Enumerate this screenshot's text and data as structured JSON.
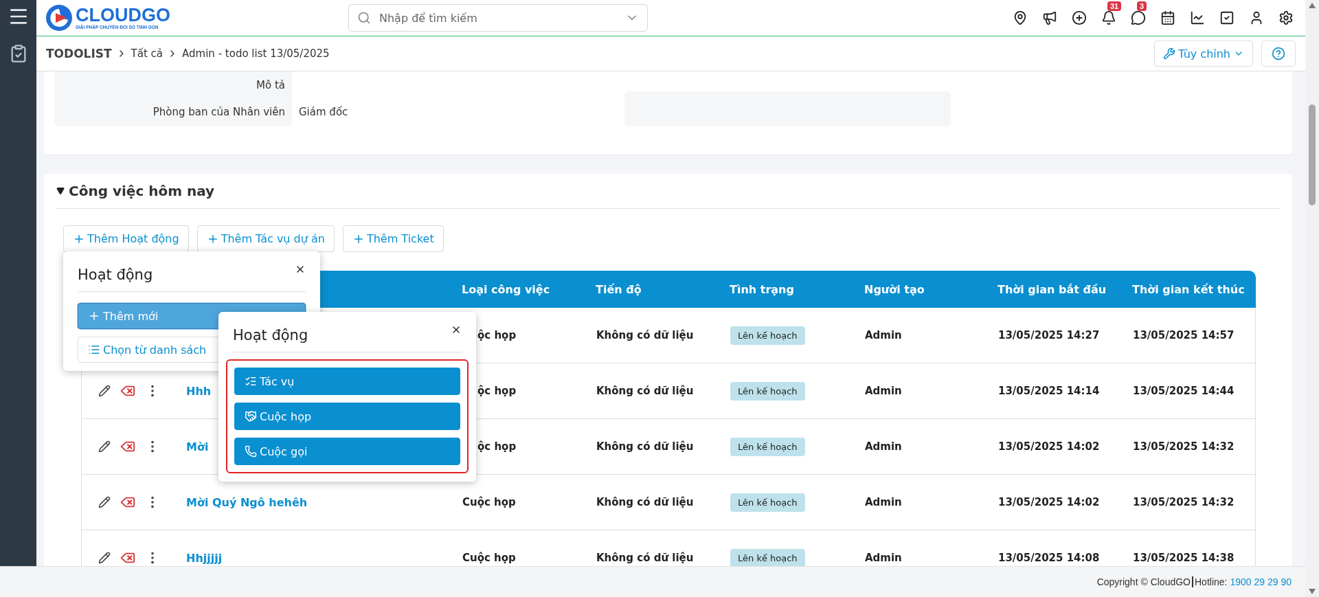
{
  "header": {
    "logo": {
      "name": "CLOUDGO",
      "tagline": "GIẢI PHÁP CHUYỂN ĐỔI SỐ TINH GỌN"
    },
    "search": {
      "placeholder": "Nhập để tìm kiếm"
    },
    "icons": [
      {
        "kind": "location"
      },
      {
        "kind": "megaphone"
      },
      {
        "kind": "add"
      },
      {
        "kind": "bell",
        "badge": "31"
      },
      {
        "kind": "chat",
        "badge": "3"
      },
      {
        "kind": "calendar"
      },
      {
        "kind": "chart"
      },
      {
        "kind": "check"
      },
      {
        "kind": "user"
      },
      {
        "kind": "settings"
      }
    ]
  },
  "breadcrumb": [
    "TODOLIST",
    "Tất cả",
    "Admin - todo list 13/05/2025"
  ],
  "toolbar": {
    "customize": "Tùy chỉnh"
  },
  "details": [
    {
      "label": "Mô tả"
    },
    {
      "label": "Phòng ban của Nhân viên",
      "value": "Giám đốc"
    }
  ],
  "section": {
    "title": "Công việc hôm nay",
    "expanded": true,
    "buttons": [
      "Thêm Hoạt động",
      "Thêm Tác vụ dự án",
      "Thêm Ticket"
    ]
  },
  "table": {
    "columns": [
      "Loại công việc",
      "Tiến độ",
      "Tình trạng",
      "Người tạo",
      "Thời gian bắt đầu",
      "Thời gian kết thúc"
    ],
    "rows": [
      {
        "actions": false,
        "covered": true,
        "type": "ộc họp",
        "progress": "Không có dữ liệu",
        "status": "Lên kế hoạch",
        "creator": "Admin",
        "start": "13/05/2025 14:27",
        "end": "13/05/2025 14:57"
      },
      {
        "actions": true,
        "covered": true,
        "name": "Hhh",
        "type": "ộc họp",
        "progress": "Không có dữ liệu",
        "status": "Lên kế hoạch",
        "creator": "Admin",
        "start": "13/05/2025 14:14",
        "end": "13/05/2025 14:44"
      },
      {
        "actions": true,
        "covered": true,
        "name": "Mời",
        "type": "ộc họp",
        "progress": "Không có dữ liệu",
        "status": "Lên kế hoạch",
        "creator": "Admin",
        "start": "13/05/2025 14:02",
        "end": "13/05/2025 14:32"
      },
      {
        "actions": true,
        "covered": false,
        "name": "Mời Quý Ngô hehêh",
        "type": "Cuộc họp",
        "progress": "Không có dữ liệu",
        "status": "Lên kế hoạch",
        "creator": "Admin",
        "start": "13/05/2025 14:02",
        "end": "13/05/2025 14:32"
      },
      {
        "actions": true,
        "covered": false,
        "name": "Hhjjjjj",
        "type": "Cuộc họp",
        "progress": "Không có dữ liệu",
        "status": "Lên kế hoạch",
        "creator": "Admin",
        "start": "13/05/2025 14:08",
        "end": "13/05/2025 14:38"
      }
    ]
  },
  "popovers": [
    {
      "title": "Hoạt động",
      "highlighted": false,
      "options": [
        {
          "label": "Thêm mới",
          "kind": "solid"
        },
        {
          "label": "Chọn từ danh sách",
          "kind": "outline"
        }
      ]
    },
    {
      "title": "Hoạt động",
      "highlighted": true,
      "options": [
        {
          "label": "Tác vụ",
          "kind": "primary"
        },
        {
          "label": "Cuộc họp",
          "kind": "primary"
        },
        {
          "label": "Cuộc gọi",
          "kind": "primary"
        }
      ]
    }
  ],
  "footer": {
    "copyright": "Copyright © CloudGO",
    "hotline_label": "Hotline:",
    "hotline": "1900 29 29 90"
  }
}
